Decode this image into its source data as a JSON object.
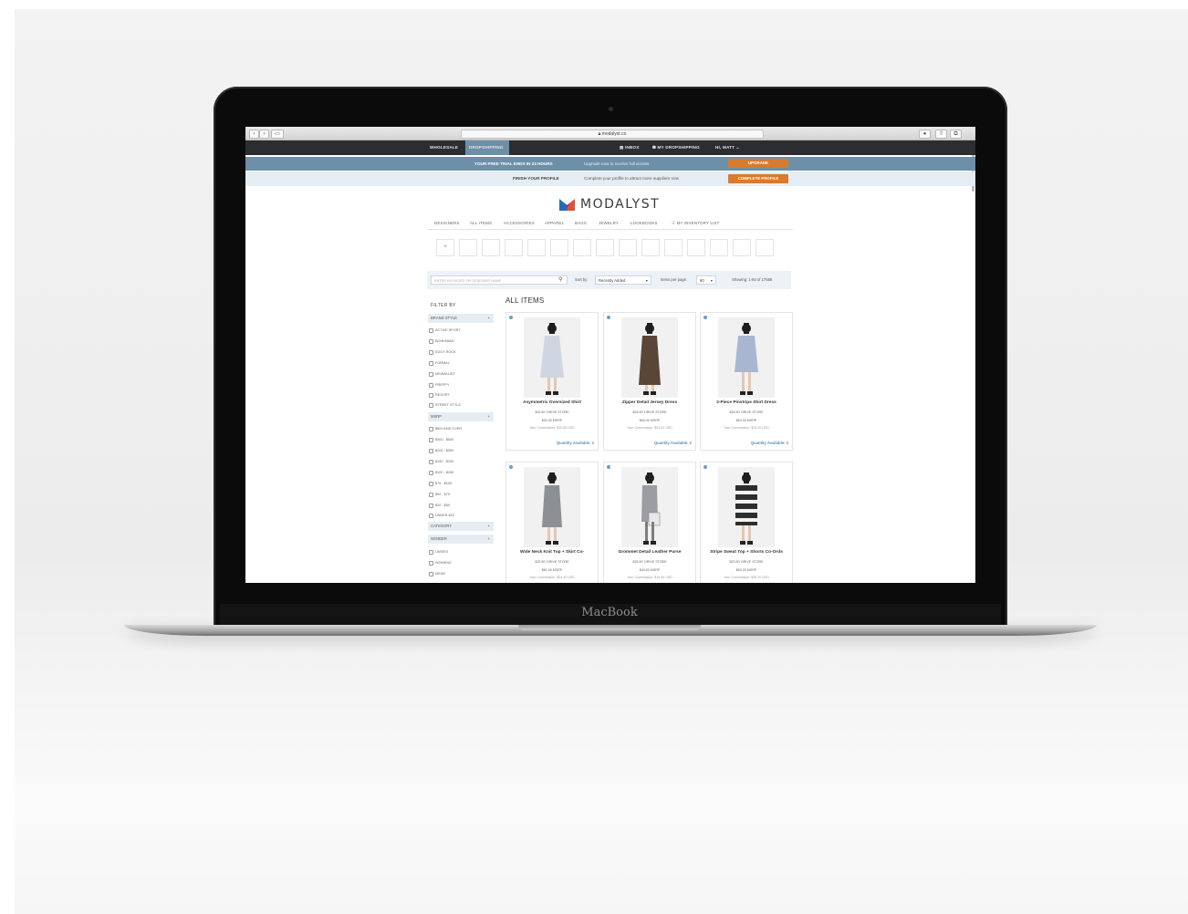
{
  "device": {
    "label": "MacBook"
  },
  "safari": {
    "url": "modalyst.co"
  },
  "topnav": {
    "tabs": [
      {
        "label": "WHOLESALE"
      },
      {
        "label": "DROPSHIPPING"
      }
    ],
    "inbox": "INBOX",
    "my_dropshipping": "MY DROPSHIPPING",
    "user": "HI, MATT"
  },
  "trial_banner": {
    "title": "YOUR FREE TRIAL ENDS IN 23 HOURS",
    "message": "Upgrade now to receive full access",
    "button": "UPGRADE"
  },
  "profile_banner": {
    "title": "FINISH YOUR PROFILE",
    "message": "Complete your profile to attract more suppliers now",
    "button": "COMPLETE PROFILE"
  },
  "brand": {
    "name": "MODALYST",
    "accent": "#3a3a3a",
    "logo_colors": [
      "#1f6fb8",
      "#e0523a",
      "#6a3aa0"
    ]
  },
  "catnav": [
    "DESIGNERS",
    "ALL ITEMS",
    "ACCESSORIES",
    "APPAREL",
    "BAGS",
    "JEWELRY",
    "LOOKBOOKS",
    "MY INVENTORY LIST"
  ],
  "search": {
    "placeholder": "ENTER KEYWORD OR DESIGNER NAME",
    "sort_label": "Sort by:",
    "sort_value": "Recently Added",
    "per_page_label": "Items per page:",
    "per_page_value": "60",
    "showing": "Showing: 1-60 of 17585"
  },
  "filters": {
    "title": "FILTER BY",
    "brand_style": {
      "label": "BRAND STYLE",
      "items": [
        "ACTIVE SPORT",
        "BOHEMIAN",
        "EDGY ROCK",
        "FORMAL",
        "MINIMALIST",
        "PREPPY",
        "RESORT",
        "STREET STYLE"
      ]
    },
    "msrp": {
      "label": "MSRP",
      "items": [
        "$500 AND OVER",
        "$300 - $500",
        "$200 - $300",
        "$150 - $200",
        "$100 - $150",
        "$75 - $100",
        "$50 - $75",
        "$20 - $50",
        "UNDER $20"
      ]
    },
    "category": {
      "label": "CATEGORY"
    },
    "gender": {
      "label": "GENDER",
      "items": [
        "UNISEX",
        "WOMENS",
        "MENS"
      ]
    }
  },
  "main": {
    "heading": "ALL ITEMS",
    "products": [
      {
        "name": "Asymmetric Oversized Shirt",
        "seller": "$25 BY DRIVE STORE",
        "msrp": "$32.00 MSRP",
        "commission": "Your Commission: $12.80 USD",
        "qty": "Quantity Available: 2",
        "color": "#cfd6e2"
      },
      {
        "name": "Zipper Detail Jersey Dress",
        "seller": "$25 BY DRIVE STORE",
        "msrp": "$60.00 MSRP",
        "commission": "Your Commission: $24.00 USD",
        "qty": "Quantity Available: 2",
        "color": "#5a4636"
      },
      {
        "name": "2-Piece Pinstripe Shirt Dress",
        "seller": "$25 BY DRIVE STORE",
        "msrp": "$63.00 MSRP",
        "commission": "Your Commission: $25.20 USD",
        "qty": "Quantity Available: 2",
        "color": "#a9b6d2"
      },
      {
        "name": "Wide Neck Knit Top + Skirt Co-",
        "seller": "$25 BY DRIVE STORE",
        "msrp": "$61.00 MSRP",
        "commission": "Your Commission: $24.40 USD",
        "color": "#8c8f93"
      },
      {
        "name": "Grommet Detail Leather Purse",
        "seller": "$25 BY DRIVE STORE",
        "msrp": "$49.00 MSRP",
        "commission": "Your Commission: $19.60 USD",
        "color": "#9a9da1"
      },
      {
        "name": "Stripe Sweat Top + Shorts Co-Ords",
        "seller": "$25 BY DRIVE STORE",
        "msrp": "$63.00 MSRP",
        "commission": "Your Commission: $25.20 USD",
        "color": "#2e2e2e"
      }
    ]
  }
}
